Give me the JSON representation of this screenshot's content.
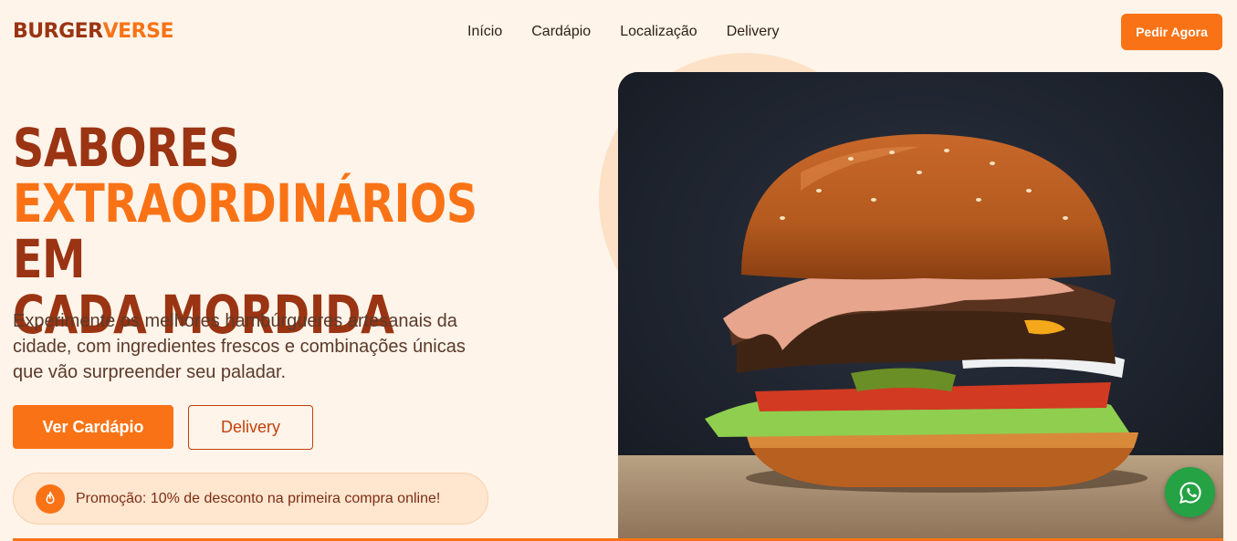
{
  "brand": {
    "part1": "BURGER",
    "part2": "VERSE"
  },
  "nav": {
    "items": [
      "Início",
      "Cardápio",
      "Localização",
      "Delivery"
    ]
  },
  "header": {
    "cta_label": "Pedir Agora"
  },
  "hero": {
    "title_line1": "SABORES",
    "title_highlight": "EXTRAORDINÁRIOS",
    "title_after_highlight": " EM",
    "title_line3": "CADA MORDIDA",
    "lead": "Experimente os melhores hambúrgueres artesanais da cidade, com ingredientes frescos e combinações únicas que vão surpreender seu paladar.",
    "primary_label": "Ver Cardápio",
    "secondary_label": "Delivery"
  },
  "promo": {
    "icon": "fire-icon",
    "text": "Promoção: 10% de desconto na primeira compra online!"
  },
  "floating": {
    "icon": "whatsapp-icon"
  },
  "colors": {
    "accent": "#f97316",
    "brand_dark": "#9a3412",
    "background": "#fff4ea",
    "whatsapp": "#25a244"
  }
}
